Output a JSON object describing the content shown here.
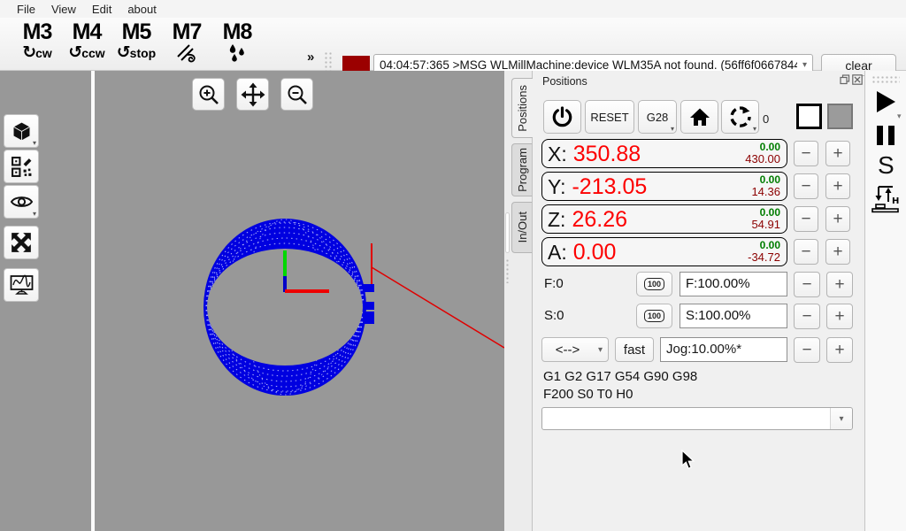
{
  "menu": {
    "items": [
      "File",
      "View",
      "Edit",
      "about"
    ]
  },
  "toolbar": {
    "mcodes": [
      {
        "code": "M3",
        "sub": "cw"
      },
      {
        "code": "M4",
        "sub": "ccw"
      },
      {
        "code": "M5",
        "sub": "stop"
      },
      {
        "code": "M7",
        "sub": ""
      },
      {
        "code": "M8",
        "sub": ""
      }
    ],
    "chevron": "»",
    "message": "04:04:57:365 >MSG WLMillMachine:device WLM35A not found. (56ff6f0667844",
    "clear": "clear"
  },
  "panel": {
    "title": "Positions",
    "tabs": [
      "Positions",
      "Program",
      "In/Out"
    ],
    "reset": "RESET",
    "g28": "G28",
    "rotate_count": "0",
    "axes": [
      {
        "label": "X:",
        "value": "350.88",
        "top": "0.00",
        "bottom": "430.00"
      },
      {
        "label": "Y:",
        "value": "-213.05",
        "top": "0.00",
        "bottom": "14.36"
      },
      {
        "label": "Z:",
        "value": "26.26",
        "top": "0.00",
        "bottom": "54.91"
      },
      {
        "label": "A:",
        "value": "0.00",
        "top": "0.00",
        "bottom": "-34.72"
      }
    ],
    "feed": {
      "label": "F:0",
      "preset": "100",
      "override": "F:100.00%"
    },
    "spindle": {
      "label": "S:0",
      "preset": "100",
      "override": "S:100.00%"
    },
    "jog": {
      "direction": "<-->",
      "fast": "fast",
      "value": "Jog:10.00%*"
    },
    "gcode_modal": "G1 G2 G17 G54 G90 G98",
    "gcode_state": "F200 S0 T0 H0"
  },
  "right_sidebar": {
    "stop_letter": "S"
  },
  "glyphs": {
    "minus": "−",
    "plus": "+",
    "dropdown": "▾",
    "cw": "↻",
    "ccw": "↺"
  },
  "colors": {
    "value_red": "#fd0000",
    "target_green": "#007d00",
    "limit_darkred": "#8b0000",
    "indicator_red": "#9b0000",
    "toolpath_blue": "#0000e0",
    "canvas_gray": "#989898"
  }
}
